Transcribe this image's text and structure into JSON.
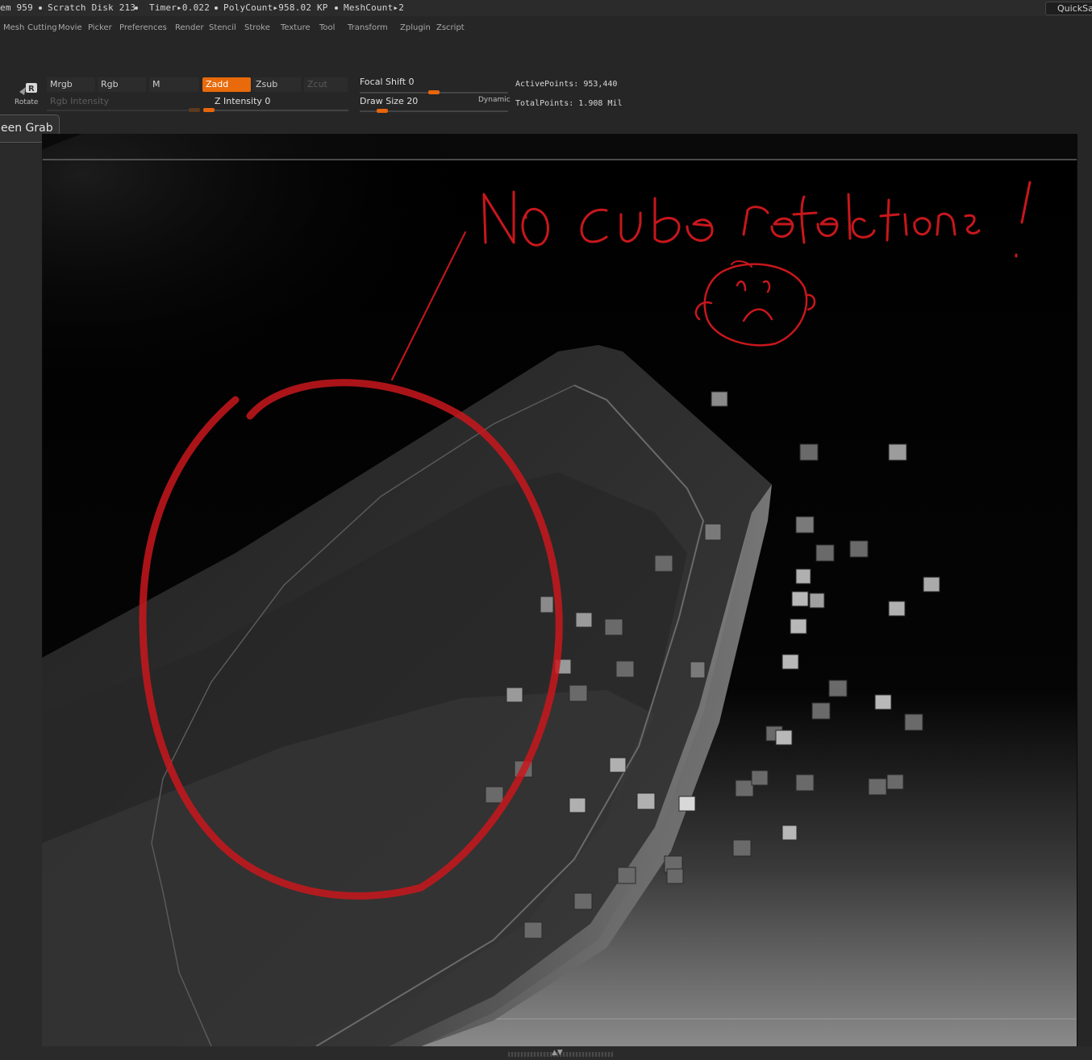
{
  "status_bar": {
    "mem": "em 959",
    "scratch": "Scratch Disk 213",
    "timer": "Timer▸0.022",
    "polycount": "PolyCount▸958.02  KP",
    "meshcount": "MeshCount▸2",
    "quicksave": "QuickSa"
  },
  "menu": [
    "Mesh",
    "Cutting",
    "Movie",
    "Picker",
    "Preferences",
    "Render",
    "Stencil",
    "Stroke",
    "Texture",
    "Tool",
    "Transform",
    "Zplugin",
    "Zscript"
  ],
  "toolbar": {
    "rotate_label": "Rotate",
    "mrgb": "Mrgb",
    "rgb": "Rgb",
    "m": "M",
    "zadd": "Zadd",
    "zsub": "Zsub",
    "zcut": "Zcut",
    "rgb_intensity": "Rgb  Intensity",
    "z_intensity": "Z  Intensity",
    "z_intensity_value": "0",
    "focal_shift": "Focal  Shift",
    "focal_shift_value": "0",
    "draw_size": "Draw  Size",
    "draw_size_value": "20",
    "dynamic": "Dynamic",
    "active_points_label": "ActivePoints:",
    "active_points": "953,440",
    "total_points_label": "TotalPoints:",
    "total_points": "1.908  Mil",
    "screen_grab": "een Grab"
  },
  "annotation": {
    "color": "#c8171c"
  },
  "colors": {
    "accent": "#e86a0b",
    "panel": "#262626"
  }
}
